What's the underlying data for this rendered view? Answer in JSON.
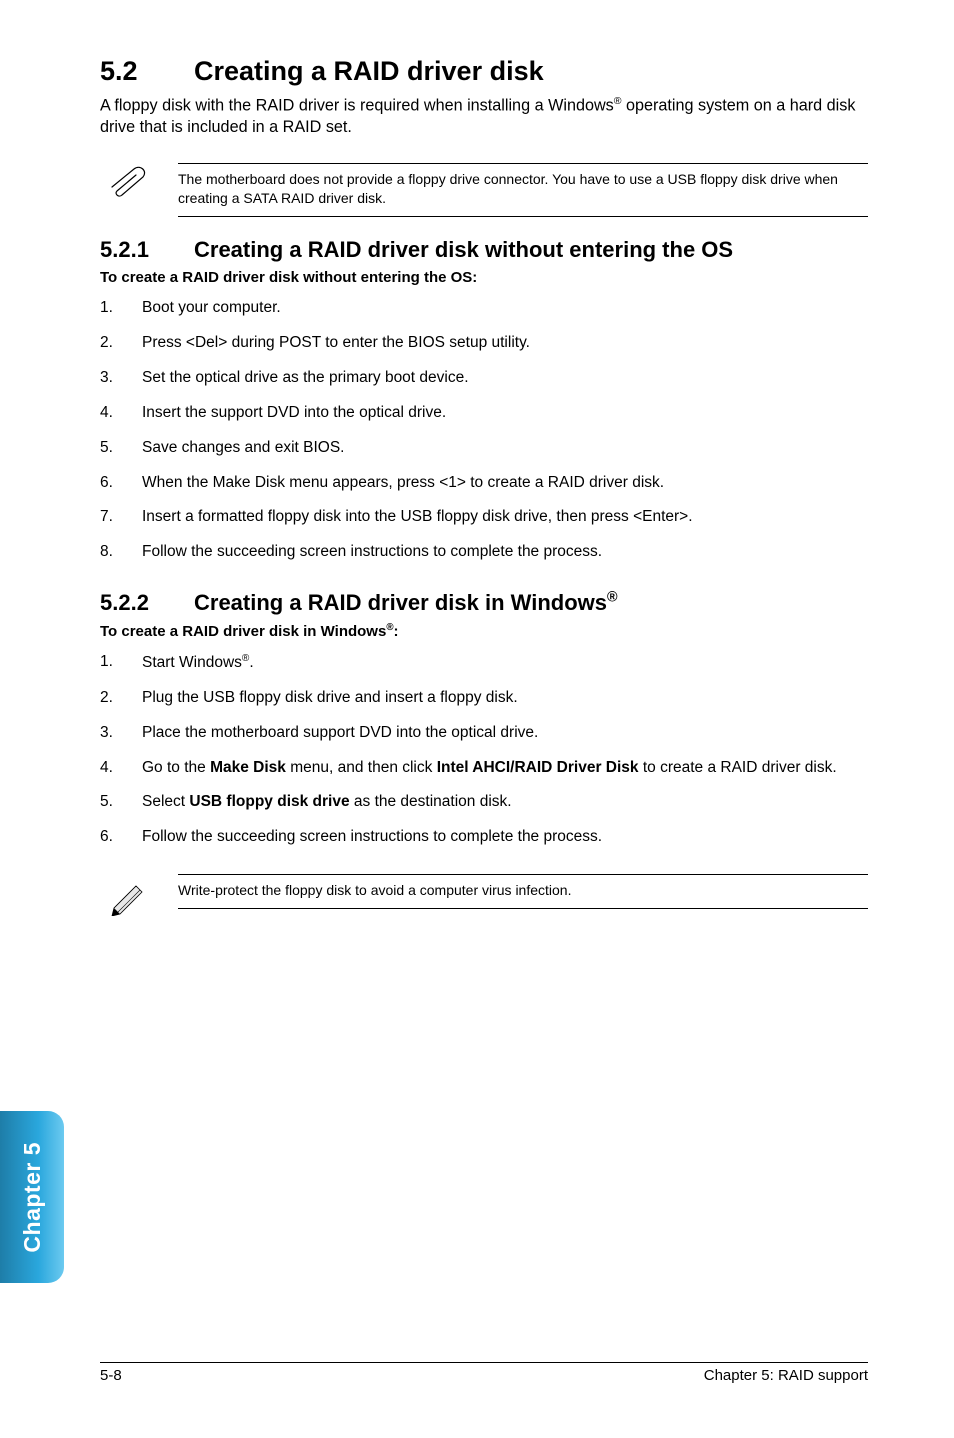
{
  "section": {
    "number": "5.2",
    "title": "Creating a RAID driver disk"
  },
  "intro_parts": {
    "p1": "A floppy disk with the RAID driver is required when installing a Windows",
    "reg1": "®",
    "p2": " operating system on a hard disk drive that is included in a RAID set."
  },
  "note1": "The motherboard does not provide a floppy drive connector. You have to use a USB floppy disk drive when creating a SATA RAID driver disk.",
  "sub1": {
    "number": "5.2.1",
    "title": "Creating a RAID driver disk without entering the OS",
    "lead": "To create a RAID driver disk without entering the OS:",
    "steps": [
      "Boot your computer.",
      "Press <Del> during POST to enter the BIOS setup utility.",
      "Set the optical drive as the primary boot device.",
      "Insert the support DVD into the optical drive.",
      "Save changes and exit BIOS.",
      "When the Make Disk menu appears, press <1> to create a RAID driver disk.",
      "Insert a formatted floppy disk into the USB floppy disk drive, then press <Enter>.",
      "Follow the succeeding screen instructions to complete the process."
    ]
  },
  "sub2": {
    "number": "5.2.2",
    "title_prefix": "Creating a RAID driver disk in Windows",
    "title_reg": "®",
    "lead_prefix": "To create a RAID driver disk in Windows",
    "lead_reg": "®",
    "lead_suffix": ":",
    "steps": [
      {
        "pre": "Start Windows",
        "reg": "®",
        "post": "."
      },
      {
        "text": "Plug the USB floppy disk drive and insert a floppy disk."
      },
      {
        "text": "Place the motherboard support DVD into the optical drive."
      },
      {
        "pre": "Go to the ",
        "b1": "Make Disk",
        "mid": " menu, and then click ",
        "b2": "Intel AHCI/RAID Driver Disk",
        "post": " to create a RAID driver disk."
      },
      {
        "pre": "Select ",
        "b1": "USB floppy disk drive",
        "post": " as the destination disk."
      },
      {
        "text": "Follow the succeeding screen instructions to complete the process."
      }
    ]
  },
  "note2": "Write-protect the floppy disk to avoid a computer virus infection.",
  "sidebar": "Chapter 5",
  "footer": {
    "left": "5-8",
    "right": "Chapter 5: RAID support"
  }
}
